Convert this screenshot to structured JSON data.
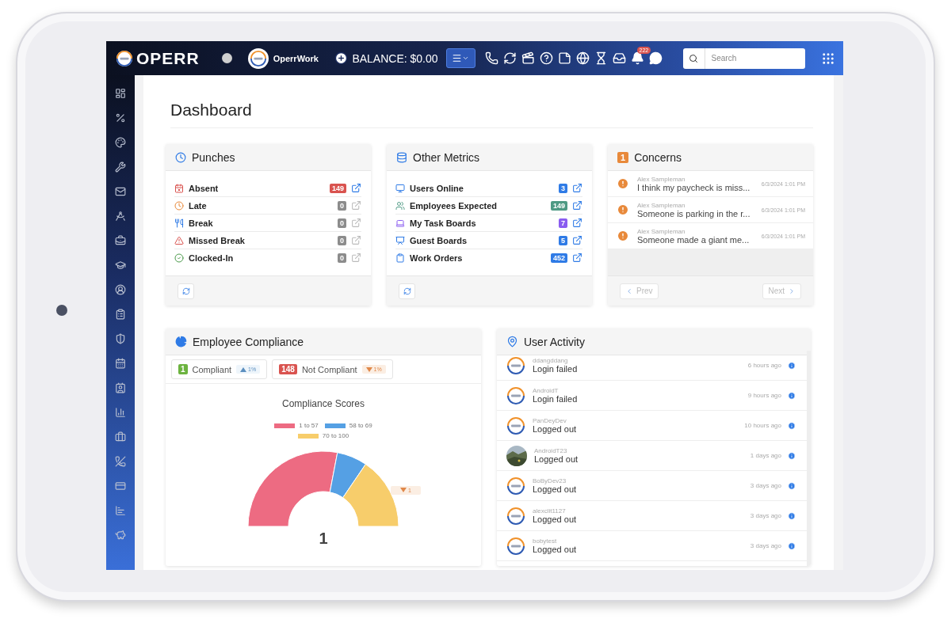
{
  "topbar": {
    "logo_text": "OPERR",
    "workspace": "OperrWork",
    "balance": "BALANCE: $0.00",
    "notification_count": "222",
    "search": {
      "placeholder": "Search"
    }
  },
  "page_title": "Dashboard",
  "punches": {
    "title": "Punches",
    "rows": [
      {
        "kind": "absent",
        "label": "Absent",
        "count": "149",
        "color": "#d9534f",
        "disabled": false
      },
      {
        "kind": "late",
        "label": "Late",
        "count": "0",
        "color": "#8c8c8c",
        "disabled": true
      },
      {
        "kind": "break",
        "label": "Break",
        "count": "0",
        "color": "#8c8c8c",
        "disabled": true
      },
      {
        "kind": "missed",
        "label": "Missed Break",
        "count": "0",
        "color": "#8c8c8c",
        "disabled": true
      },
      {
        "kind": "clocked",
        "label": "Clocked-In",
        "count": "0",
        "color": "#8c8c8c",
        "disabled": true
      }
    ]
  },
  "metrics": {
    "title": "Other Metrics",
    "rows": [
      {
        "kind": "online",
        "label": "Users Online",
        "count": "3",
        "color": "#2f7be6",
        "disabled": false
      },
      {
        "kind": "expected",
        "label": "Employees Expected",
        "count": "149",
        "color": "#4e9a84",
        "disabled": false
      },
      {
        "kind": "boards",
        "label": "My Task Boards",
        "count": "7",
        "color": "#8a5cf0",
        "disabled": false
      },
      {
        "kind": "guest",
        "label": "Guest Boards",
        "count": "5",
        "color": "#2f7be6",
        "disabled": false
      },
      {
        "kind": "orders",
        "label": "Work Orders",
        "count": "452",
        "color": "#2f7be6",
        "disabled": false
      }
    ]
  },
  "concerns": {
    "title": "Concerns",
    "count": "1",
    "items": [
      {
        "author": "Alex Sampleman",
        "message": "I think my paycheck is miss...",
        "time": "6/3/2024 1:01 PM"
      },
      {
        "author": "Alex Sampleman",
        "message": "Someone is parking in the r...",
        "time": "6/3/2024 1:01 PM"
      },
      {
        "author": "Alex Sampleman",
        "message": "Someone made a giant me...",
        "time": "6/3/2024 1:01 PM"
      }
    ],
    "buttons": [
      {
        "label": "Prev",
        "kind": "prev",
        "disabled": true
      },
      {
        "label": "Next",
        "kind": "next",
        "disabled": true
      }
    ]
  },
  "compliance": {
    "title": "Employee Compliance",
    "stats": [
      {
        "count": "1",
        "label": "Compliant",
        "trend": "1%",
        "kind": "up",
        "color": "#6cb33f"
      },
      {
        "count": "148",
        "label": "Not Compliant",
        "trend": "1%",
        "kind": "down",
        "color": "#d9534f"
      }
    ],
    "chart_title": "Compliance Scores",
    "legend": [
      {
        "label": "1 to 57",
        "color": "#ed6b82"
      },
      {
        "label": "58 to 69",
        "color": "#55a0e4"
      },
      {
        "label": "70 to 100",
        "color": "#f7cd6b"
      }
    ],
    "center_value": "1",
    "side_badge": {
      "value": "1",
      "kind": "down"
    }
  },
  "activity": {
    "title": "User Activity",
    "items": [
      {
        "user": "ddangddang",
        "action": "Login failed",
        "time": "6 hours ago",
        "kind": "logo"
      },
      {
        "user": "AndroidT",
        "action": "Login failed",
        "time": "9 hours ago",
        "kind": "logo"
      },
      {
        "user": "PanDeyDev",
        "action": "Logged out",
        "time": "10 hours ago",
        "kind": "logo"
      },
      {
        "user": "AndroidT23",
        "action": "Logged out",
        "time": "1 days ago",
        "kind": "picture"
      },
      {
        "user": "BoByDev23",
        "action": "Logged out",
        "time": "3 days ago",
        "kind": "logo"
      },
      {
        "user": "alexclit1127",
        "action": "Logged out",
        "time": "3 days ago",
        "kind": "logo"
      },
      {
        "user": "bobytest",
        "action": "Logged out",
        "time": "3 days ago",
        "kind": "logo"
      }
    ]
  }
}
